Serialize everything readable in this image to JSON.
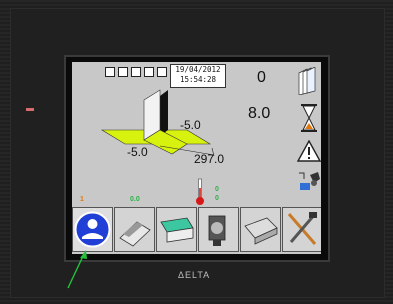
{
  "device": {
    "led_label": "",
    "brand": "ΔELTA"
  },
  "screen": {
    "date": "19/04/2012",
    "time": "15:54:28",
    "counter": "0",
    "time_value": "8.0",
    "dim_a": "-5.0",
    "dim_b": "-5.0",
    "dim_c": "297.0",
    "orange_value": "1",
    "green_value": "0.0",
    "temp_top": "0",
    "temp_bottom": "0"
  },
  "colors": {
    "screen_bg": "#c8c8c8",
    "accent_green": "#2db34a",
    "accent_orange": "#e07a10",
    "active_blue": "#1f3fd6",
    "arrow_green": "#22c33a"
  },
  "toolbar": {
    "buttons": [
      {
        "icon": "operator-mode-icon"
      },
      {
        "icon": "sheet-feeder-icon"
      },
      {
        "icon": "folding-unit-icon"
      },
      {
        "icon": "gear-mechanism-icon"
      },
      {
        "icon": "magazine-icon"
      },
      {
        "icon": "tools-icon"
      }
    ]
  },
  "right_icons": [
    "sheets-stack-icon",
    "hourglass-icon",
    "warning-icon",
    "robot-gripper-icon"
  ]
}
